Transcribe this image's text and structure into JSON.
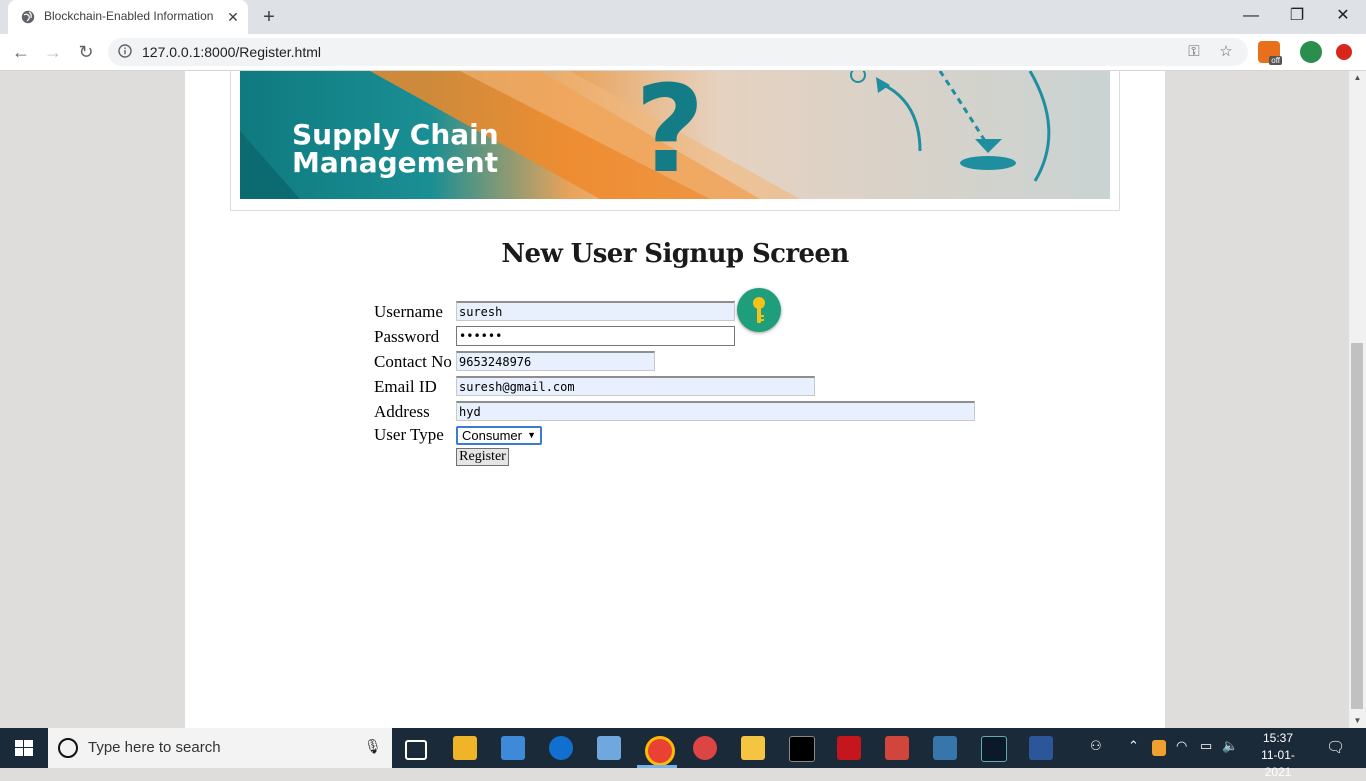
{
  "browser": {
    "tab_title": "Blockchain-Enabled Information",
    "url": "127.0.0.1:8000/Register.html",
    "extension_badge": "off"
  },
  "banner": {
    "line1": "Supply Chain",
    "line2": "Management",
    "symbol": "?"
  },
  "page": {
    "title": "New User Signup Screen"
  },
  "form": {
    "username_label": "Username",
    "username_value": "suresh",
    "password_label": "Password",
    "password_value": "••••••",
    "contact_label": "Contact No",
    "contact_value": "9653248976",
    "email_label": "Email ID",
    "email_value": "suresh@gmail.com",
    "address_label": "Address",
    "address_value": "hyd",
    "usertype_label": "User Type",
    "usertype_value": "Consumer",
    "register_label": "Register"
  },
  "taskbar": {
    "search_placeholder": "Type here to search",
    "time": "15:37",
    "date": "11-01-2021"
  },
  "colors": {
    "accent": "#1e9e7a",
    "autofill_bg": "#e8f0fe",
    "taskbar": "#1b2a38"
  }
}
